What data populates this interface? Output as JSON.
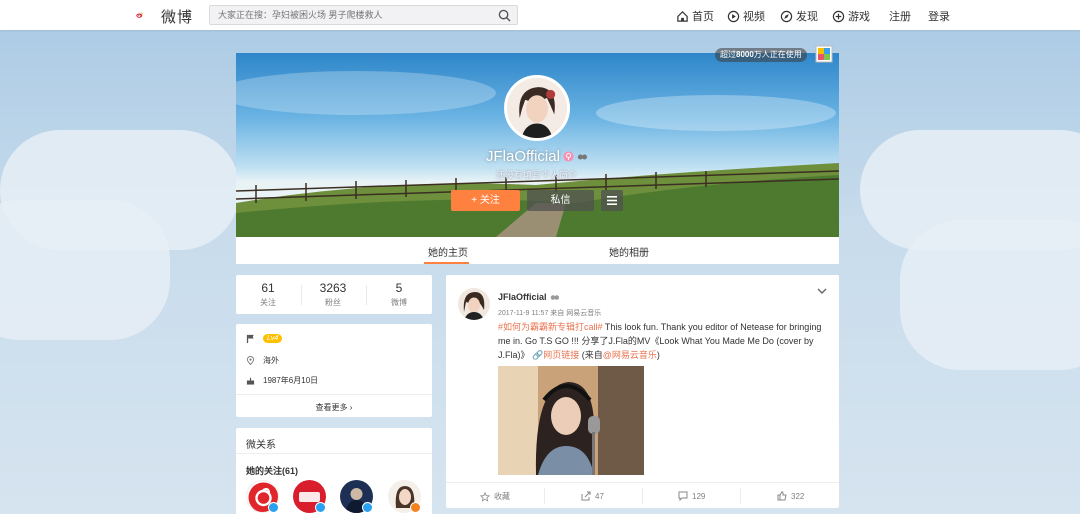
{
  "topbar": {
    "logo_text": "微博",
    "search_placeholder": "大家正在搜：孕妇被困火场 男子爬楼救人",
    "nav": [
      {
        "label": "首页",
        "icon": "home-icon"
      },
      {
        "label": "视频",
        "icon": "video-icon"
      },
      {
        "label": "发现",
        "icon": "discover-icon"
      },
      {
        "label": "游戏",
        "icon": "game-icon"
      }
    ],
    "register": "注册",
    "login": "登录"
  },
  "cover": {
    "badge_prefix": "超过",
    "badge_number": "8000",
    "badge_suffix": "万人正在使用",
    "name": "JFlaOfficial",
    "subtitle": "还没有填写个人简介",
    "follow_label": "关注",
    "message_label": "私信"
  },
  "tabs": [
    {
      "label": "她的主页",
      "active": true
    },
    {
      "label": "她的相册",
      "active": false
    }
  ],
  "stats": [
    {
      "value": "61",
      "label": "关注"
    },
    {
      "value": "3263",
      "label": "粉丝"
    },
    {
      "value": "5",
      "label": "微博"
    }
  ],
  "info": {
    "level": "Lv4",
    "location": "海外",
    "birthday": "1987年6月10日",
    "more": "查看更多"
  },
  "relations": {
    "title": "微关系",
    "following_title": "她的关注(61)"
  },
  "post": {
    "author": "JFlaOfficial",
    "time": "2017-11-9 11:57",
    "source_prefix": "来自",
    "source": "网易云音乐",
    "hashtag": "#如何为霸霸新专辑打call#",
    "text1": " This look fun. Thank you editor of Netease for bringing me in. Go T.S GO !!!  分享了J.Fla的MV《Look What You Made Me Do (cover by J.Fla)》 ",
    "link_label": "网页链接",
    "text2": " (来自",
    "mention": "@网易云音乐",
    "text3": ")"
  },
  "actions": [
    {
      "label": "收藏",
      "icon": "star-icon"
    },
    {
      "label": "47",
      "icon": "share-icon"
    },
    {
      "label": "129",
      "icon": "comment-icon"
    },
    {
      "label": "322",
      "icon": "like-icon"
    }
  ],
  "colors": {
    "accent": "#ff8140",
    "link": "#eb7350",
    "level": "#ffc000"
  }
}
